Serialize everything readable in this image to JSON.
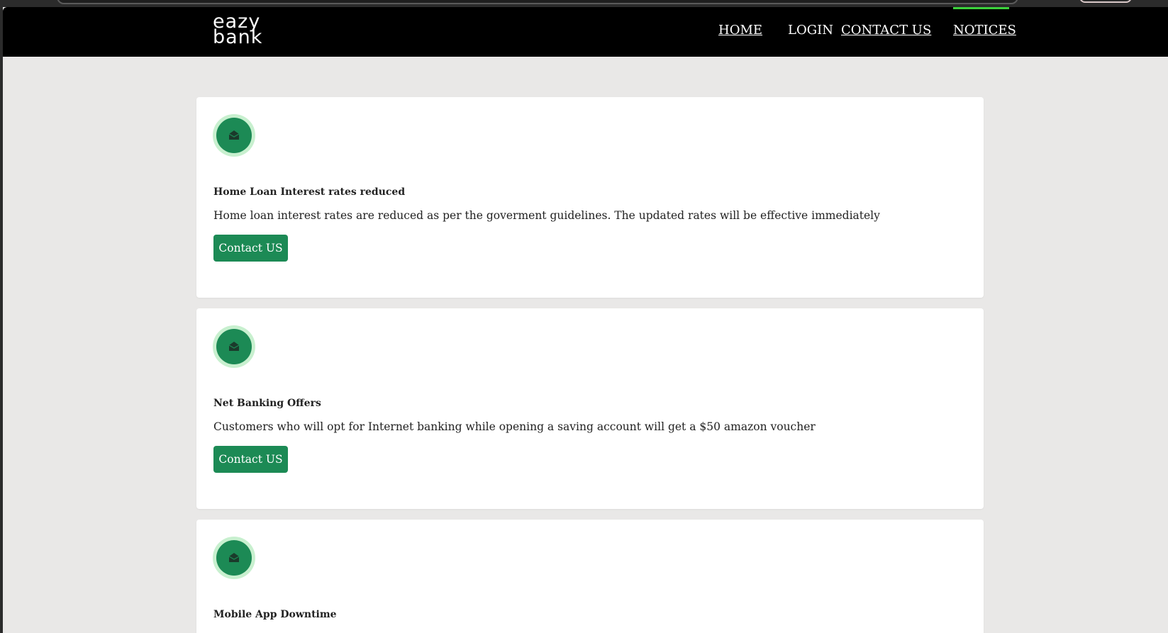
{
  "brand": {
    "logo_line1": "eazy",
    "logo_line2": "bank"
  },
  "nav": {
    "items": [
      {
        "label": "HOME",
        "underlined": true,
        "active": false
      },
      {
        "label": "LOGIN",
        "underlined": false,
        "active": false
      },
      {
        "label": "CONTACT US",
        "underlined": true,
        "active": false
      },
      {
        "label": "NOTICES",
        "underlined": true,
        "active": true
      }
    ]
  },
  "notices": [
    {
      "title": "Home Loan Interest rates reduced",
      "body": "Home loan interest rates are reduced as per the goverment guidelines. The updated rates will be effective immediately",
      "button_label": "Contact US"
    },
    {
      "title": "Net Banking Offers",
      "body": "Customers who will opt for Internet banking while opening a saving account will get a $50 amazon voucher",
      "button_label": "Contact US"
    },
    {
      "title": "Mobile App Downtime",
      "body": "",
      "button_label": ""
    }
  ],
  "icons": {
    "notice_icon": "envelope-open-icon"
  },
  "colors": {
    "header_bg": "#000000",
    "page_bg": "#e9e8e7",
    "accent_green": "#1c8a55",
    "icon_ring": "#c8f0cf",
    "active_tab_bar": "#3cd13c"
  }
}
